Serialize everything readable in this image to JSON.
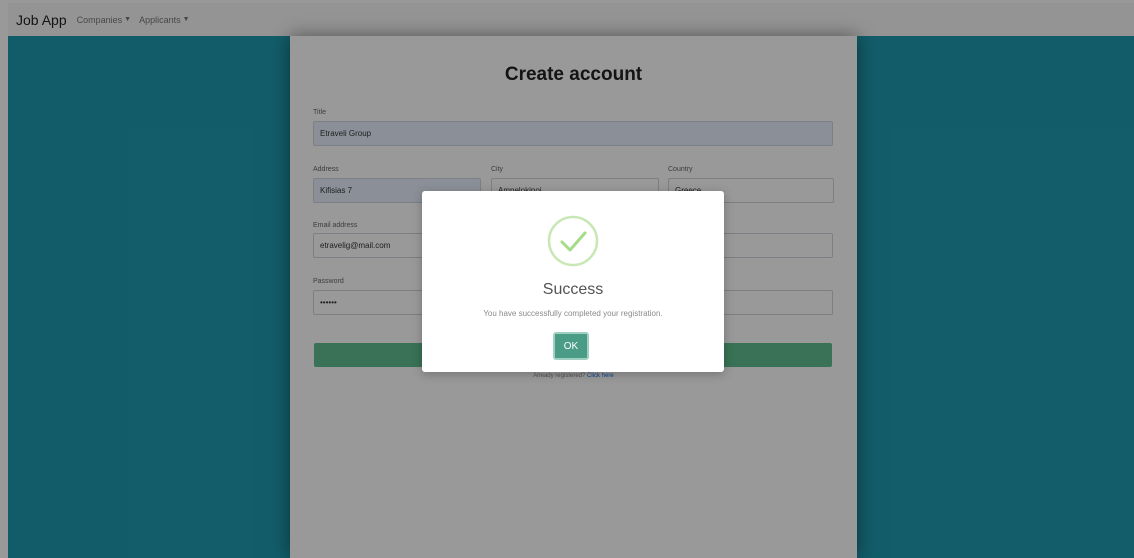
{
  "navbar": {
    "brand": "Job App",
    "menus": [
      {
        "label": "Companies"
      },
      {
        "label": "Applicants"
      }
    ]
  },
  "form": {
    "title": "Create account",
    "fields": {
      "title": {
        "label": "Title",
        "value": "Etraveli Group"
      },
      "address": {
        "label": "Address",
        "value": "Kifisias 7"
      },
      "city": {
        "label": "City",
        "value": "Ampelokipoi"
      },
      "country": {
        "label": "Country",
        "value": "Greece"
      },
      "email": {
        "label": "Email address",
        "value": "etravelig@mail.com"
      },
      "password": {
        "label": "Password",
        "value": "••••••"
      }
    },
    "login_text": "Already registered?",
    "login_link": "Click here"
  },
  "modal": {
    "title": "Success",
    "message": "You have successfully completed your registration.",
    "ok_label": "OK"
  },
  "colors": {
    "background": "#1f9ab0",
    "success_green": "#a5dc86",
    "ok_button": "#4a9c86",
    "submit_bar": "#5fbf8f"
  },
  "icons": {
    "menu_caret": "caret-down-icon",
    "success": "check-circle-icon"
  }
}
